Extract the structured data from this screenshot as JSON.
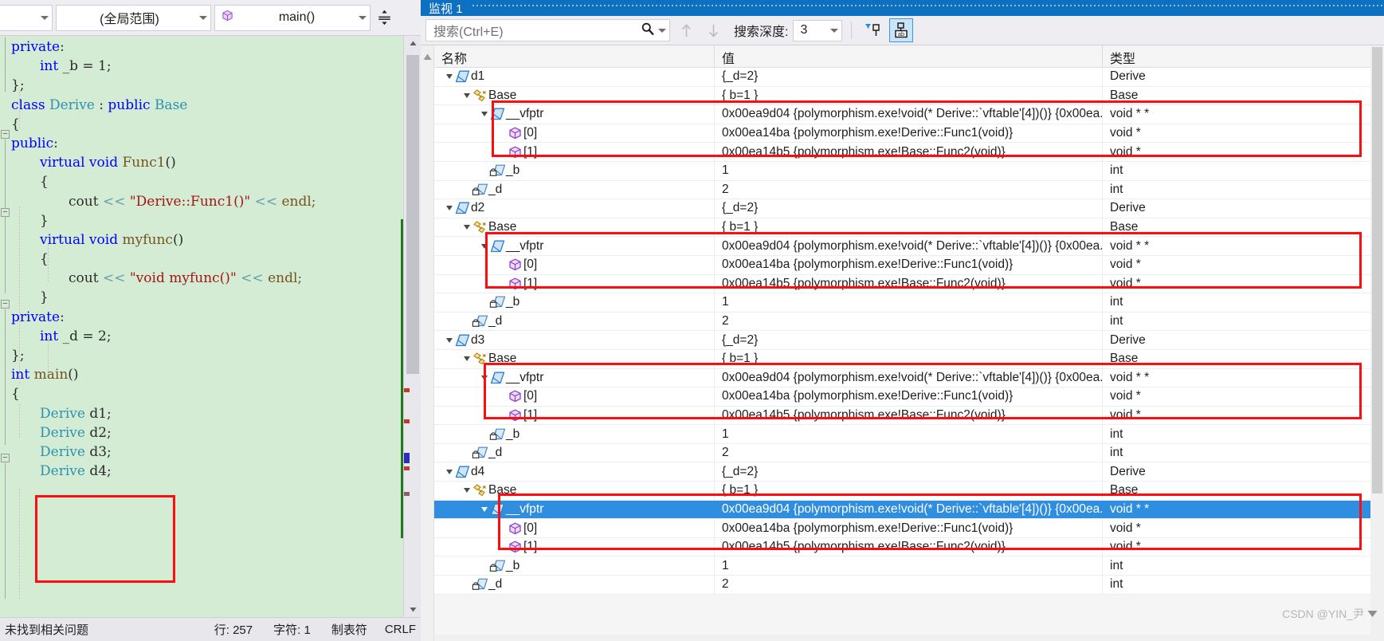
{
  "editor": {
    "navbar": {
      "project_combo": "",
      "scope_combo": "(全局范围)",
      "member_combo": "main()",
      "split_icon": "split-window-icon"
    },
    "code_lines": [
      {
        "indent": 0,
        "tokens": [
          {
            "t": "private",
            "c": "kw"
          },
          {
            "t": ":",
            "c": "pl"
          }
        ]
      },
      {
        "indent": 1,
        "tokens": [
          {
            "t": "int",
            "c": "kw"
          },
          {
            "t": " _b = 1;",
            "c": "pl"
          }
        ]
      },
      {
        "indent": 0,
        "tokens": [
          {
            "t": "};",
            "c": "pl"
          }
        ]
      },
      {
        "indent": 0,
        "tokens": [
          {
            "t": "class ",
            "c": "kw"
          },
          {
            "t": "Derive",
            "c": "typ"
          },
          {
            "t": " : ",
            "c": "pl"
          },
          {
            "t": "public ",
            "c": "kw"
          },
          {
            "t": "Base",
            "c": "typ"
          }
        ]
      },
      {
        "indent": 0,
        "tokens": [
          {
            "t": "{",
            "c": "pl"
          }
        ]
      },
      {
        "indent": 0,
        "tokens": [
          {
            "t": "public",
            "c": "kw"
          },
          {
            "t": ":",
            "c": "pl"
          }
        ]
      },
      {
        "indent": 1,
        "tokens": [
          {
            "t": "virtual void ",
            "c": "kw"
          },
          {
            "t": "Func1",
            "c": "fn"
          },
          {
            "t": "()",
            "c": "pl"
          }
        ]
      },
      {
        "indent": 1,
        "tokens": [
          {
            "t": "{",
            "c": "pl"
          }
        ]
      },
      {
        "indent": 2,
        "tokens": [
          {
            "t": "cout ",
            "c": "pl"
          },
          {
            "t": "<< ",
            "c": "op"
          },
          {
            "t": "\"Derive::Func1()\"",
            "c": "str"
          },
          {
            "t": " << ",
            "c": "op"
          },
          {
            "t": "endl;",
            "c": "ws"
          }
        ]
      },
      {
        "indent": 1,
        "tokens": [
          {
            "t": "}",
            "c": "pl"
          }
        ]
      },
      {
        "indent": 1,
        "tokens": [
          {
            "t": "virtual void ",
            "c": "kw"
          },
          {
            "t": "myfunc",
            "c": "fn"
          },
          {
            "t": "()",
            "c": "pl"
          }
        ]
      },
      {
        "indent": 1,
        "tokens": [
          {
            "t": "{",
            "c": "pl"
          }
        ]
      },
      {
        "indent": 2,
        "tokens": [
          {
            "t": "cout ",
            "c": "pl"
          },
          {
            "t": "<< ",
            "c": "op"
          },
          {
            "t": "\"void myfunc()\"",
            "c": "str"
          },
          {
            "t": " << ",
            "c": "op"
          },
          {
            "t": "endl;",
            "c": "ws"
          }
        ]
      },
      {
        "indent": 1,
        "tokens": [
          {
            "t": "}",
            "c": "pl"
          }
        ]
      },
      {
        "indent": 0,
        "tokens": [
          {
            "t": "private",
            "c": "kw"
          },
          {
            "t": ":",
            "c": "pl"
          }
        ]
      },
      {
        "indent": 1,
        "tokens": [
          {
            "t": "int",
            "c": "kw"
          },
          {
            "t": " _d = 2;",
            "c": "pl"
          }
        ]
      },
      {
        "indent": 0,
        "tokens": [
          {
            "t": "};",
            "c": "pl"
          }
        ]
      },
      {
        "indent": 0,
        "tokens": [
          {
            "t": "int ",
            "c": "kw"
          },
          {
            "t": "main",
            "c": "fn"
          },
          {
            "t": "()",
            "c": "pl"
          }
        ]
      },
      {
        "indent": 0,
        "tokens": [
          {
            "t": "{",
            "c": "pl"
          }
        ]
      },
      {
        "indent": 1,
        "tokens": [
          {
            "t": "Derive",
            "c": "typ"
          },
          {
            "t": " d1;",
            "c": "pl"
          }
        ]
      },
      {
        "indent": 1,
        "tokens": [
          {
            "t": "Derive",
            "c": "typ"
          },
          {
            "t": " d2;",
            "c": "pl"
          }
        ]
      },
      {
        "indent": 1,
        "tokens": [
          {
            "t": "Derive",
            "c": "typ"
          },
          {
            "t": " d3;",
            "c": "pl"
          }
        ]
      },
      {
        "indent": 1,
        "tokens": [
          {
            "t": "Derive",
            "c": "typ"
          },
          {
            "t": " d4;",
            "c": "pl"
          }
        ]
      }
    ],
    "status_bar": {
      "problems": "未找到相关问题",
      "line": "行: 257",
      "column": "字符: 1",
      "tabs": "制表符",
      "eol": "CRLF"
    }
  },
  "watch": {
    "tab_label": "监视 1",
    "toolbar": {
      "search_placeholder": "搜索(Ctrl+E)",
      "search_icon": "magnifier-icon",
      "search_dropdown_icon": "chevron-down-icon",
      "prev_icon": "arrow-up-icon",
      "next_icon": "arrow-down-icon",
      "depth_label": "搜索深度:",
      "depth_value": "3",
      "pin_filter_icon": "pin-filter-icon",
      "pin_hex_icon": "pin-ab-icon"
    },
    "columns": {
      "name": "名称",
      "value": "值",
      "type": "类型"
    },
    "rows": [
      {
        "depth": 0,
        "expander": "open",
        "icon": "object-icon",
        "name": "d1",
        "value": "{_d=2}",
        "type": "Derive"
      },
      {
        "depth": 1,
        "expander": "open",
        "icon": "base-class-icon",
        "name": "Base",
        "value": "{ b=1 }",
        "type": "Base"
      },
      {
        "depth": 2,
        "expander": "open",
        "icon": "object-icon",
        "name": "__vfptr",
        "value": "0x00ea9d04 {polymorphism.exe!void(* Derive::`vftable'[4])()} {0x00ea...",
        "type": "void * *"
      },
      {
        "depth": 3,
        "expander": "none",
        "icon": "array-elem-icon",
        "name": "[0]",
        "value": "0x00ea14ba {polymorphism.exe!Derive::Func1(void)}",
        "type": "void *"
      },
      {
        "depth": 3,
        "expander": "none",
        "icon": "array-elem-icon",
        "name": "[1]",
        "value": "0x00ea14b5 {polymorphism.exe!Base::Func2(void)}",
        "type": "void *"
      },
      {
        "depth": 2,
        "expander": "none",
        "icon": "private-field-icon",
        "name": "_b",
        "value": "1",
        "type": "int"
      },
      {
        "depth": 1,
        "expander": "none",
        "icon": "private-field-icon",
        "name": "_d",
        "value": "2",
        "type": "int"
      },
      {
        "depth": 0,
        "expander": "open",
        "icon": "object-icon",
        "name": "d2",
        "value": "{_d=2}",
        "type": "Derive"
      },
      {
        "depth": 1,
        "expander": "open",
        "icon": "base-class-icon",
        "name": "Base",
        "value": "{ b=1 }",
        "type": "Base"
      },
      {
        "depth": 2,
        "expander": "open",
        "icon": "object-icon",
        "name": "__vfptr",
        "value": "0x00ea9d04 {polymorphism.exe!void(* Derive::`vftable'[4])()} {0x00ea...",
        "type": "void * *"
      },
      {
        "depth": 3,
        "expander": "none",
        "icon": "array-elem-icon",
        "name": "[0]",
        "value": "0x00ea14ba {polymorphism.exe!Derive::Func1(void)}",
        "type": "void *"
      },
      {
        "depth": 3,
        "expander": "none",
        "icon": "array-elem-icon",
        "name": "[1]",
        "value": "0x00ea14b5 {polymorphism.exe!Base::Func2(void)}",
        "type": "void *"
      },
      {
        "depth": 2,
        "expander": "none",
        "icon": "private-field-icon",
        "name": "_b",
        "value": "1",
        "type": "int"
      },
      {
        "depth": 1,
        "expander": "none",
        "icon": "private-field-icon",
        "name": "_d",
        "value": "2",
        "type": "int"
      },
      {
        "depth": 0,
        "expander": "open",
        "icon": "object-icon",
        "name": "d3",
        "value": "{_d=2}",
        "type": "Derive"
      },
      {
        "depth": 1,
        "expander": "open",
        "icon": "base-class-icon",
        "name": "Base",
        "value": "{ b=1 }",
        "type": "Base"
      },
      {
        "depth": 2,
        "expander": "open",
        "icon": "object-icon",
        "name": "__vfptr",
        "value": "0x00ea9d04 {polymorphism.exe!void(* Derive::`vftable'[4])()} {0x00ea...",
        "type": "void * *"
      },
      {
        "depth": 3,
        "expander": "none",
        "icon": "array-elem-icon",
        "name": "[0]",
        "value": "0x00ea14ba {polymorphism.exe!Derive::Func1(void)}",
        "type": "void *"
      },
      {
        "depth": 3,
        "expander": "none",
        "icon": "array-elem-icon",
        "name": "[1]",
        "value": "0x00ea14b5 {polymorphism.exe!Base::Func2(void)}",
        "type": "void *"
      },
      {
        "depth": 2,
        "expander": "none",
        "icon": "private-field-icon",
        "name": "_b",
        "value": "1",
        "type": "int"
      },
      {
        "depth": 1,
        "expander": "none",
        "icon": "private-field-icon",
        "name": "_d",
        "value": "2",
        "type": "int"
      },
      {
        "depth": 0,
        "expander": "open",
        "icon": "object-icon",
        "name": "d4",
        "value": "{_d=2}",
        "type": "Derive"
      },
      {
        "depth": 1,
        "expander": "open",
        "icon": "base-class-icon",
        "name": "Base",
        "value": "{ b=1 }",
        "type": "Base"
      },
      {
        "depth": 2,
        "expander": "open",
        "icon": "object-icon",
        "name": "__vfptr",
        "value": "0x00ea9d04 {polymorphism.exe!void(* Derive::`vftable'[4])()} {0x00ea...",
        "type": "void * *",
        "selected": true
      },
      {
        "depth": 3,
        "expander": "none",
        "icon": "array-elem-icon",
        "name": "[0]",
        "value": "0x00ea14ba {polymorphism.exe!Derive::Func1(void)}",
        "type": "void *"
      },
      {
        "depth": 3,
        "expander": "none",
        "icon": "array-elem-icon",
        "name": "[1]",
        "value": "0x00ea14b5 {polymorphism.exe!Base::Func2(void)}",
        "type": "void *"
      },
      {
        "depth": 2,
        "expander": "none",
        "icon": "private-field-icon",
        "name": "_b",
        "value": "1",
        "type": "int"
      },
      {
        "depth": 1,
        "expander": "none",
        "icon": "private-field-icon",
        "name": "_d",
        "value": "2",
        "type": "int"
      }
    ],
    "watermark": "CSDN @YIN_尹"
  },
  "colors": {
    "accent": "#0e70c0",
    "selection": "#2f8ee0",
    "annotation": "#fd0d0d",
    "editor_bg": "#d4ecd4"
  }
}
